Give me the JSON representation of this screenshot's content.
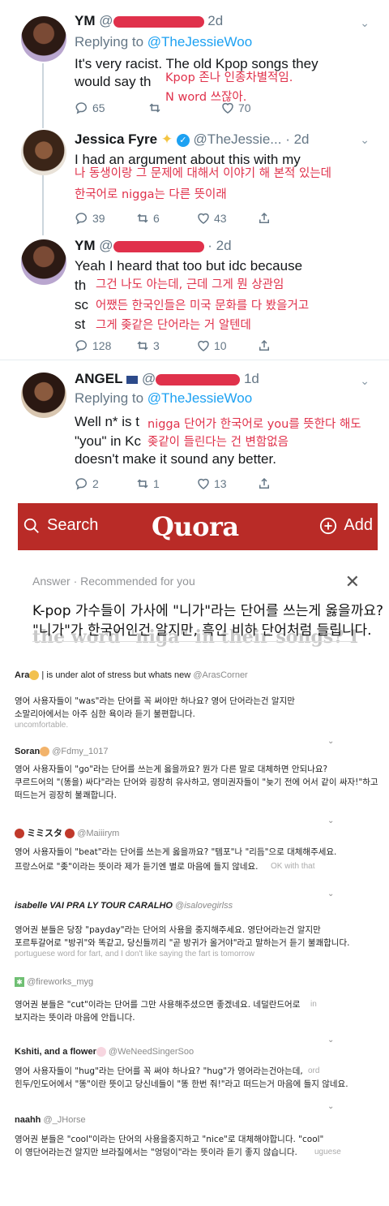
{
  "tweets": [
    {
      "name": "YM",
      "handle": "@",
      "time": "2d",
      "replying_prefix": "Replying to ",
      "replying_handle": "@TheJessieWoo",
      "body_lines": [
        "It's very racist. The old Kpop songs they",
        "would say th"
      ],
      "overlay": [
        "Kpop 존나 인종차별적임.",
        "N word 쓰잖아."
      ],
      "replies": "65",
      "retweets": "",
      "likes": "70"
    },
    {
      "name": "Jessica Fyre",
      "handle": "@TheJessie...",
      "time": "· 2d",
      "body_lines": [
        "I had an argument about this with my"
      ],
      "overlay": [
        "나 동생이랑 그 문제에 대해서 이야기 해 본적 있는데",
        "한국어로 nigga는 다른 뜻이래"
      ],
      "replies": "39",
      "retweets": "6",
      "likes": "43"
    },
    {
      "name": "YM",
      "handle": "@",
      "time": "· 2d",
      "body_lines": [
        "Yeah I heard that too but idc because",
        "th",
        "sc",
        "st"
      ],
      "overlay": [
        "그건 나도 아는데, 근데 그게 뭔 상관임",
        "어쨌든 한국인들은 미국 문화를 다 봤을거고",
        "그게 좆같은 단어라는 거 알텐데"
      ],
      "replies": "128",
      "retweets": "3",
      "likes": "10"
    },
    {
      "name": "ANGEL",
      "handle": "@",
      "time": "1d",
      "replying_prefix": "Replying to ",
      "replying_handle": "@TheJessieWoo",
      "body_lines": [
        "Well n* is t",
        "\"you\" in Kc",
        "doesn't make it sound any better."
      ],
      "overlay": [
        "nigga 단어가 한국어로 you를 뜻한다 해도",
        "좆같이 들린다는 건 변함없음"
      ],
      "replies": "2",
      "retweets": "1",
      "likes": "13"
    }
  ],
  "quora": {
    "search_label": "Search",
    "logo": "Quora",
    "add_label": "Add",
    "answer_header": "Answer · Recommended for you",
    "question_line1": "K-pop 가수들이 가사에 \"니가\"라는 단어를 쓰는게 옳을까요?",
    "question_line2": "\"니가\"가 한국어인건 알지만, 흑인 비하 단어처럼 들립니다.",
    "ghost_text": "the word \"niga\" in their songs? I"
  },
  "replies": [
    {
      "name": "Ara",
      "bio": " | is under alot of stress but whats new",
      "handle": "@ArasCorner",
      "kr": [
        "영어 사용자들이 \"was\"라는 단어를 꼭 써야만 하나요? 영어 단어라는건 알지만",
        "소말리아에서는 아주 심한 욕이라 듣기 불편합니다."
      ],
      "en": "uncomfortable."
    },
    {
      "name": "Soran",
      "bio": "",
      "handle": "@Fdmy_1017",
      "kr": [
        "영어 사용자들이 \"go\"라는 단어를 쓰는게 옳을까요? 뭔가 다른 말로 대체하면 안되나요?",
        "쿠르드어의 \"(똥을) 싸다\"라는 단어와 굉장히 유사하고, 영미권자들이 \"늦기 전에 어서 같이 싸자!\"하고",
        "떠드는거 굉장히 불쾌합니다."
      ],
      "en": ""
    },
    {
      "name": "ミミスタ",
      "bio": "",
      "handle": "@Maiiirym",
      "kr": [
        "영어 사용자들이 \"beat\"라는 단어를 쓰는게 옳을까요? \"템포\"나 \"리듬\"으로 대체해주세요.",
        "프랑스어로 \"좆\"이라는 뜻이라 제가 듣기엔 별로 마음에 들지 않네요."
      ],
      "en": "OK with that"
    },
    {
      "name": "isabelle VAI PRA LY TOUR CARALHO",
      "bio": "",
      "handle": "@isalovegirlss",
      "kr": [
        "영어권 분들은 당장 \"payday\"라는 단어의 사용을 중지해주세요. 영단어라는건 알지만",
        "포르투갈어로 \"방귀\"와 똑같고, 당신들끼리 \"곧 방귀가 올거야\"라고 말하는거 듣기 불쾌합니다."
      ],
      "en": "portuguese word for fart, and I don't like saying the fart is tomorrow"
    },
    {
      "name": "",
      "bio": "",
      "handle": "@fireworks_myg",
      "kr": [
        "영어권 분들은 \"cut\"이라는 단어를 그만 사용해주셨으면 좋겠네요. 네덜란드어로",
        "보지라는 뜻이라 마음에 안듭니다."
      ],
      "en": "in"
    },
    {
      "name": "Kshiti, and a flower",
      "bio": "",
      "handle": "@WeNeedSingerSoo",
      "kr": [
        "영어 사용자들이 \"hug\"라는 단어를 꼭 써야 하나요? \"hug\"가 영어라는건아는데,",
        "힌두/인도어에서 \"똥\"이란 뜻이고 당신네들이 \"똥 한번 줘!\"라고 떠드는거 마음에 들지 않네요."
      ],
      "en": "ord"
    },
    {
      "name": "naahh",
      "bio": "",
      "handle": "@_JHorse",
      "kr": [
        "영어권 분들은 \"cool\"이라는 단어의 사용을중지하고 \"nice\"로 대체해야합니다. \"cool\"",
        "이 영단어라는건 알지만 브라질에서는 \"엉덩이\"라는 뜻이라 듣기 좋지 않습니다."
      ],
      "en": "uguese"
    }
  ]
}
